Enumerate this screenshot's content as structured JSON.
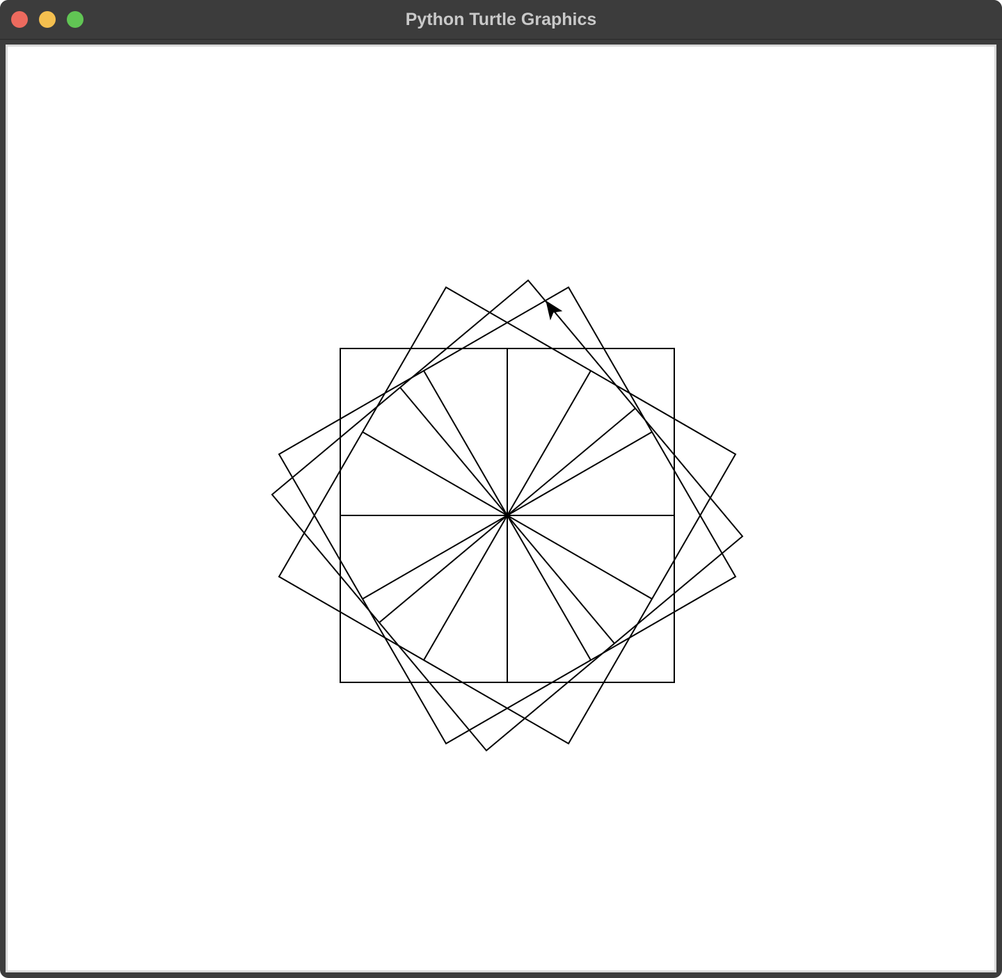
{
  "window": {
    "title": "Python Turtle Graphics"
  },
  "canvas": {
    "background": "#ffffff",
    "pen_color": "#000000",
    "pointer_icon": "turtle-arrow-icon"
  }
}
